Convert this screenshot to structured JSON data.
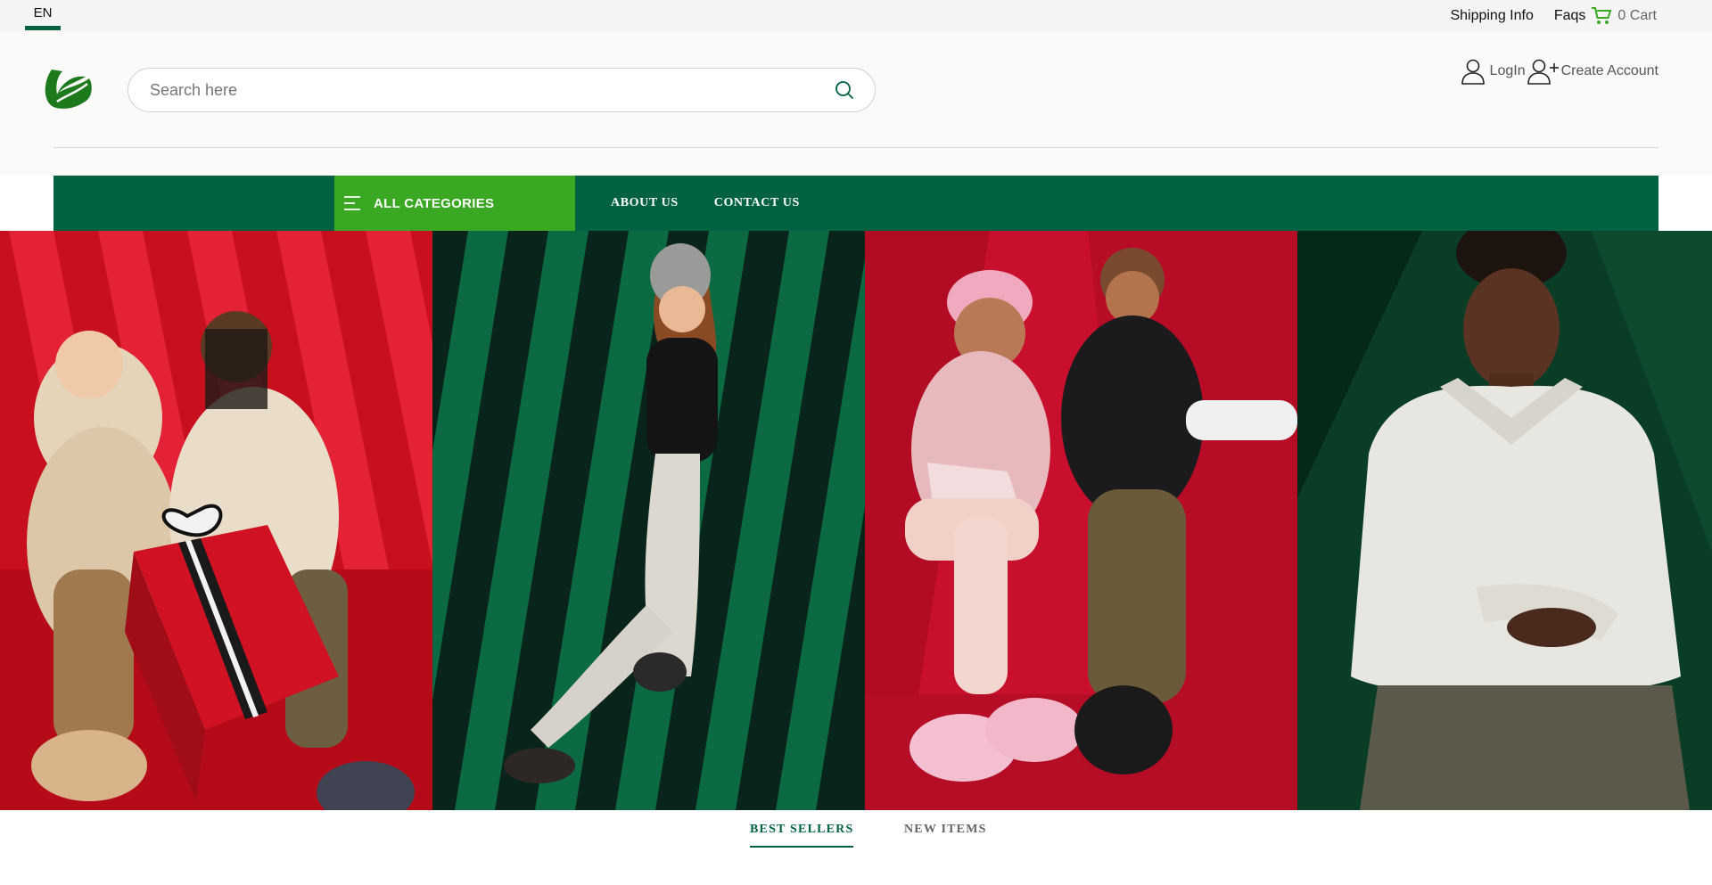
{
  "topbar": {
    "language": "EN",
    "shipping_info": "Shipping Info",
    "faqs": "Faqs",
    "cart_label": "0 Cart"
  },
  "header": {
    "search_placeholder": "Search here",
    "login": "LogIn",
    "create_account": "Create Account"
  },
  "nav": {
    "all_categories": "ALL CATEGORIES",
    "about_us": "ABOUT US",
    "contact_us": "CONTACT US"
  },
  "tabs": {
    "best_sellers": "BEST SELLERS",
    "new_items": "NEW ITEMS"
  },
  "colors": {
    "brand_green": "#016241",
    "accent_green": "#3aa823",
    "hero_red": "#c8102e"
  },
  "icons": [
    "leaf-logo",
    "cart-icon",
    "search-icon",
    "user-icon",
    "add-user-icon",
    "hamburger-icon"
  ]
}
